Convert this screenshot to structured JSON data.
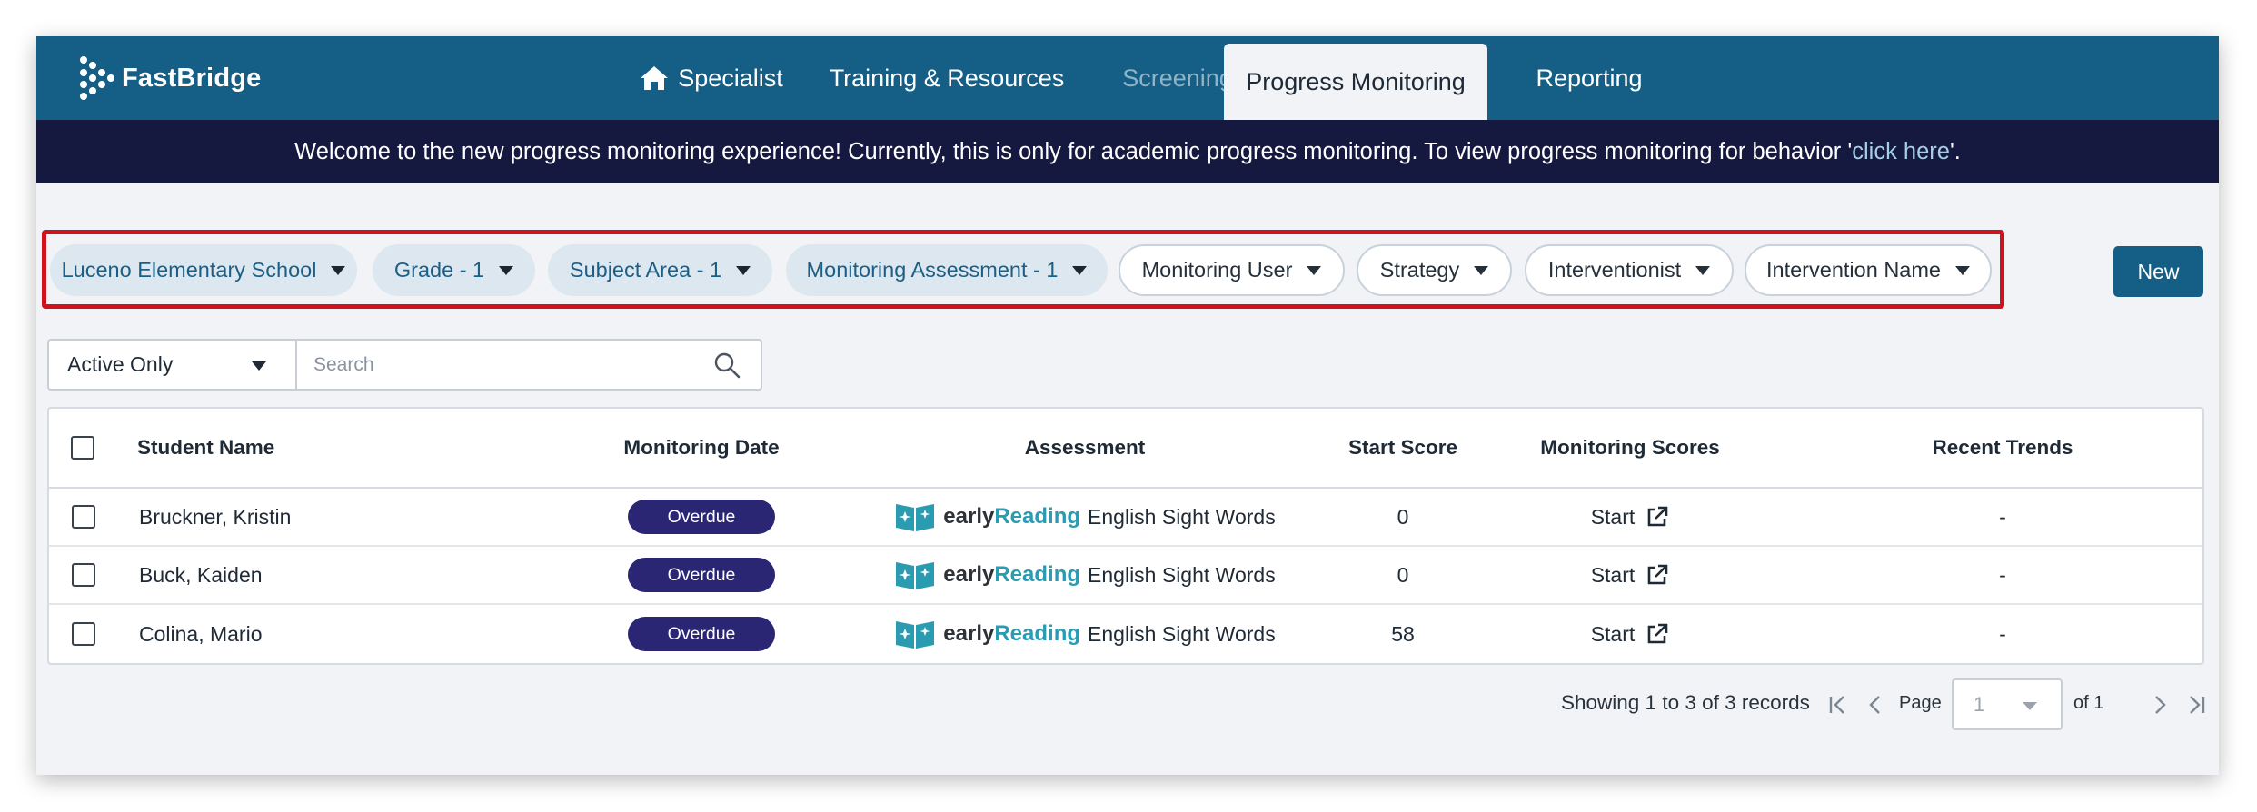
{
  "app": {
    "name": "FastBridge"
  },
  "nav": {
    "items": [
      {
        "label": "Specialist",
        "icon": "home-icon"
      },
      {
        "label": "Training & Resources"
      },
      {
        "label": "Screening",
        "state": "disabled"
      },
      {
        "label": "Progress Monitoring",
        "state": "active"
      },
      {
        "label": "Reporting"
      }
    ]
  },
  "banner": {
    "text": "Welcome to the new progress monitoring experience! Currently, this is only for academic progress monitoring. To view progress monitoring for behavior '",
    "link": "click here",
    "suffix": "'."
  },
  "filters": [
    {
      "label": "Luceno Elementary School",
      "style": "filled"
    },
    {
      "label": "Grade - 1",
      "style": "filled"
    },
    {
      "label": "Subject Area - 1",
      "style": "filled"
    },
    {
      "label": "Monitoring Assessment - 1",
      "style": "filled"
    },
    {
      "label": "Monitoring User",
      "style": "outline"
    },
    {
      "label": "Strategy",
      "style": "outline"
    },
    {
      "label": "Interventionist",
      "style": "outline"
    },
    {
      "label": "Intervention Name",
      "style": "outline"
    }
  ],
  "new_button": "New",
  "toolbar": {
    "status_value": "Active Only",
    "search_placeholder": "Search"
  },
  "table": {
    "columns": [
      "Student Name",
      "Monitoring Date",
      "Assessment",
      "Start Score",
      "Monitoring Scores",
      "Recent Trends"
    ],
    "rows": [
      {
        "name": "Bruckner, Kristin",
        "status": "Overdue",
        "assessment_brand_a": "early",
        "assessment_brand_b": "Reading",
        "assessment": "English Sight Words",
        "start_score": "0",
        "monitoring": "Start",
        "trend": "-"
      },
      {
        "name": "Buck, Kaiden",
        "status": "Overdue",
        "assessment_brand_a": "early",
        "assessment_brand_b": "Reading",
        "assessment": "English Sight Words",
        "start_score": "0",
        "monitoring": "Start",
        "trend": "-"
      },
      {
        "name": "Colina, Mario",
        "status": "Overdue",
        "assessment_brand_a": "early",
        "assessment_brand_b": "Reading",
        "assessment": "English Sight Words",
        "start_score": "58",
        "monitoring": "Start",
        "trend": "-"
      }
    ]
  },
  "pagination": {
    "summary": "Showing 1 to 3 of 3 records",
    "page_label": "Page",
    "page_value": "1",
    "of_label": "of 1"
  },
  "colors": {
    "nav_bg": "#155e85",
    "banner_bg": "#15193f",
    "badge_bg": "#2a2673",
    "highlight_border": "#d0121d",
    "reading_accent": "#2a9bb1"
  }
}
